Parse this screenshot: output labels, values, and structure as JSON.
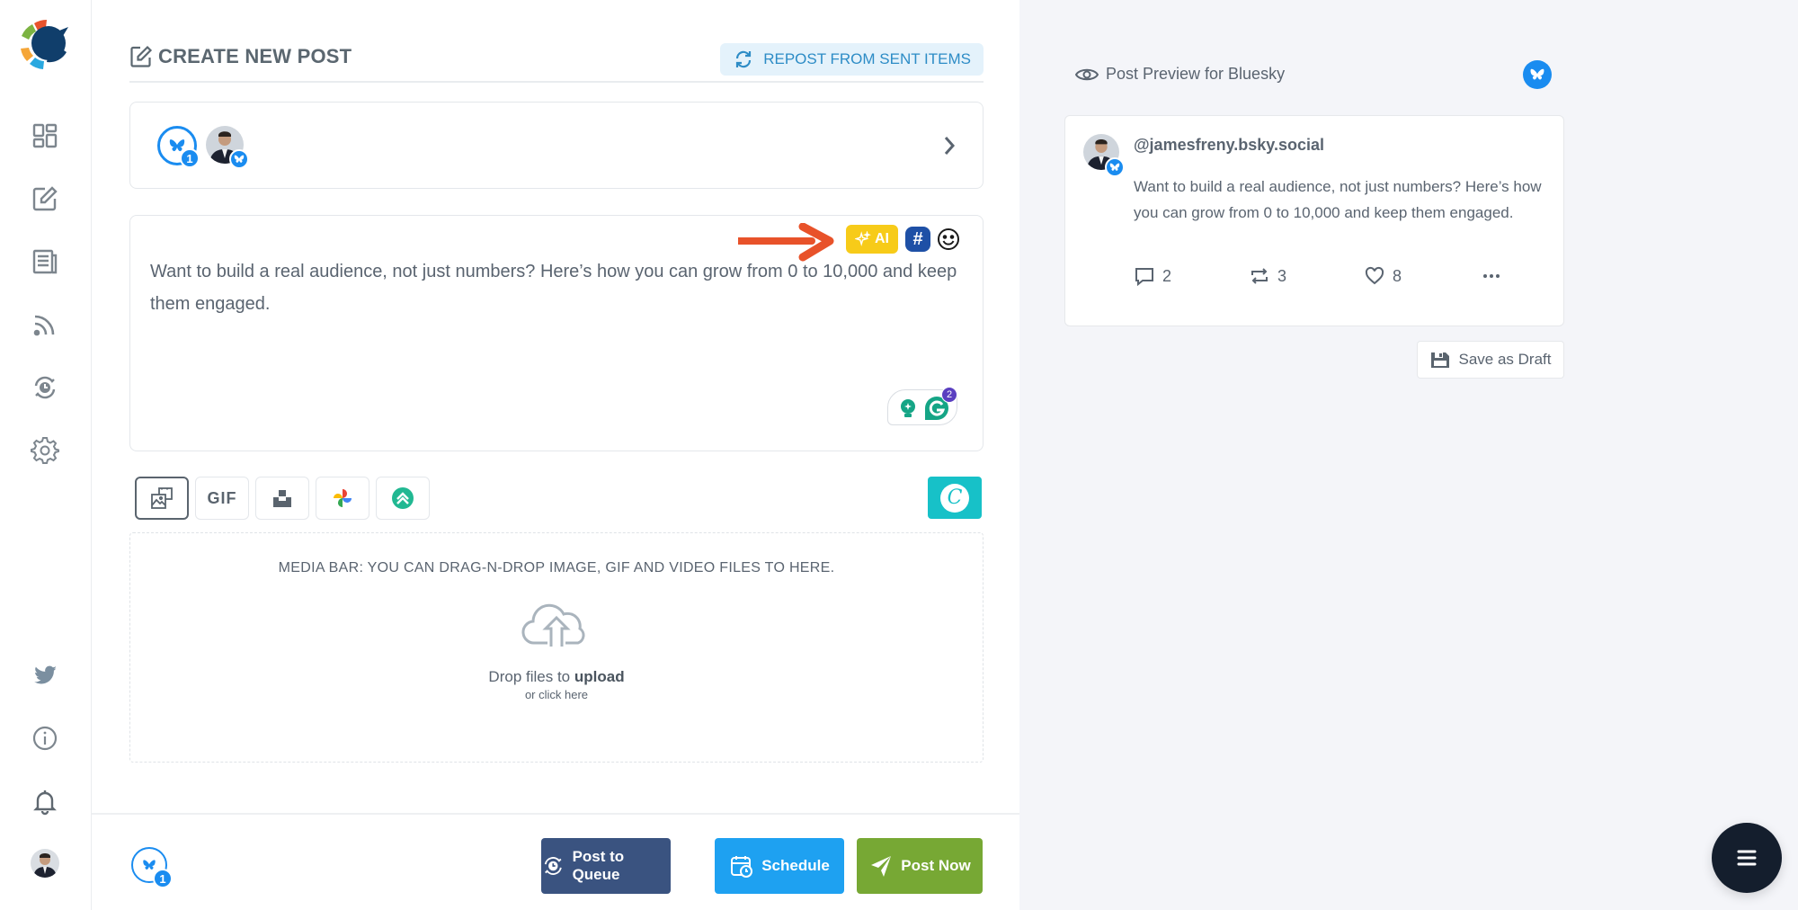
{
  "sidebar": {
    "logo": "app-logo",
    "items": [
      {
        "name": "dashboard",
        "icon": "grid-icon"
      },
      {
        "name": "compose",
        "icon": "edit-icon"
      },
      {
        "name": "posts",
        "icon": "newspaper-icon"
      },
      {
        "name": "feeds",
        "icon": "rss-icon"
      },
      {
        "name": "queue",
        "icon": "clock-refresh-icon"
      },
      {
        "name": "settings",
        "icon": "gear-icon"
      }
    ],
    "bottom_items": [
      {
        "name": "twitter",
        "icon": "twitter-icon"
      },
      {
        "name": "info",
        "icon": "info-icon"
      },
      {
        "name": "notifications",
        "icon": "bell-icon"
      },
      {
        "name": "profile",
        "icon": "avatar"
      }
    ]
  },
  "header": {
    "title": "CREATE NEW POST",
    "repost_label": "REPOST FROM SENT ITEMS"
  },
  "accounts": {
    "network": "Bluesky",
    "selected_count": "1"
  },
  "editor": {
    "ai_label": "AI",
    "hashtag_label": "#",
    "text": "Want to build a real audience, not just numbers? Here’s how you can grow from 0 to 10,000 and keep them engaged.",
    "grammarly_count": "2"
  },
  "media_tools": [
    {
      "name": "image-upload",
      "label": ""
    },
    {
      "name": "gif",
      "label": "GIF"
    },
    {
      "name": "unsplash",
      "label": ""
    },
    {
      "name": "google-photos",
      "label": ""
    },
    {
      "name": "dropbox-like",
      "label": ""
    }
  ],
  "canva_label": "C",
  "dropzone": {
    "title": "MEDIA BAR: YOU CAN DRAG-N-DROP IMAGE, GIF AND VIDEO FILES TO HERE.",
    "main_prefix": "Drop files to ",
    "main_bold": "upload",
    "sub": "or click here"
  },
  "footer": {
    "selected_count": "1",
    "queue_label": "Post to Queue",
    "schedule_label": "Schedule",
    "post_now_label": "Post Now"
  },
  "preview": {
    "title": "Post Preview for Bluesky",
    "handle": "@jamesfreny.bsky.social",
    "text": "Want to build a real audience, not just numbers? Here’s how you can grow from 0 to 10,000 and keep them engaged.",
    "replies": "2",
    "reposts": "3",
    "likes": "8",
    "save_draft_label": "Save as Draft"
  },
  "colors": {
    "bluesky": "#1a8cf0",
    "queue": "#3a5380",
    "schedule": "#1ea1f1",
    "post_now": "#77a834",
    "ai": "#f7cb19",
    "canva": "#17c1c8"
  }
}
